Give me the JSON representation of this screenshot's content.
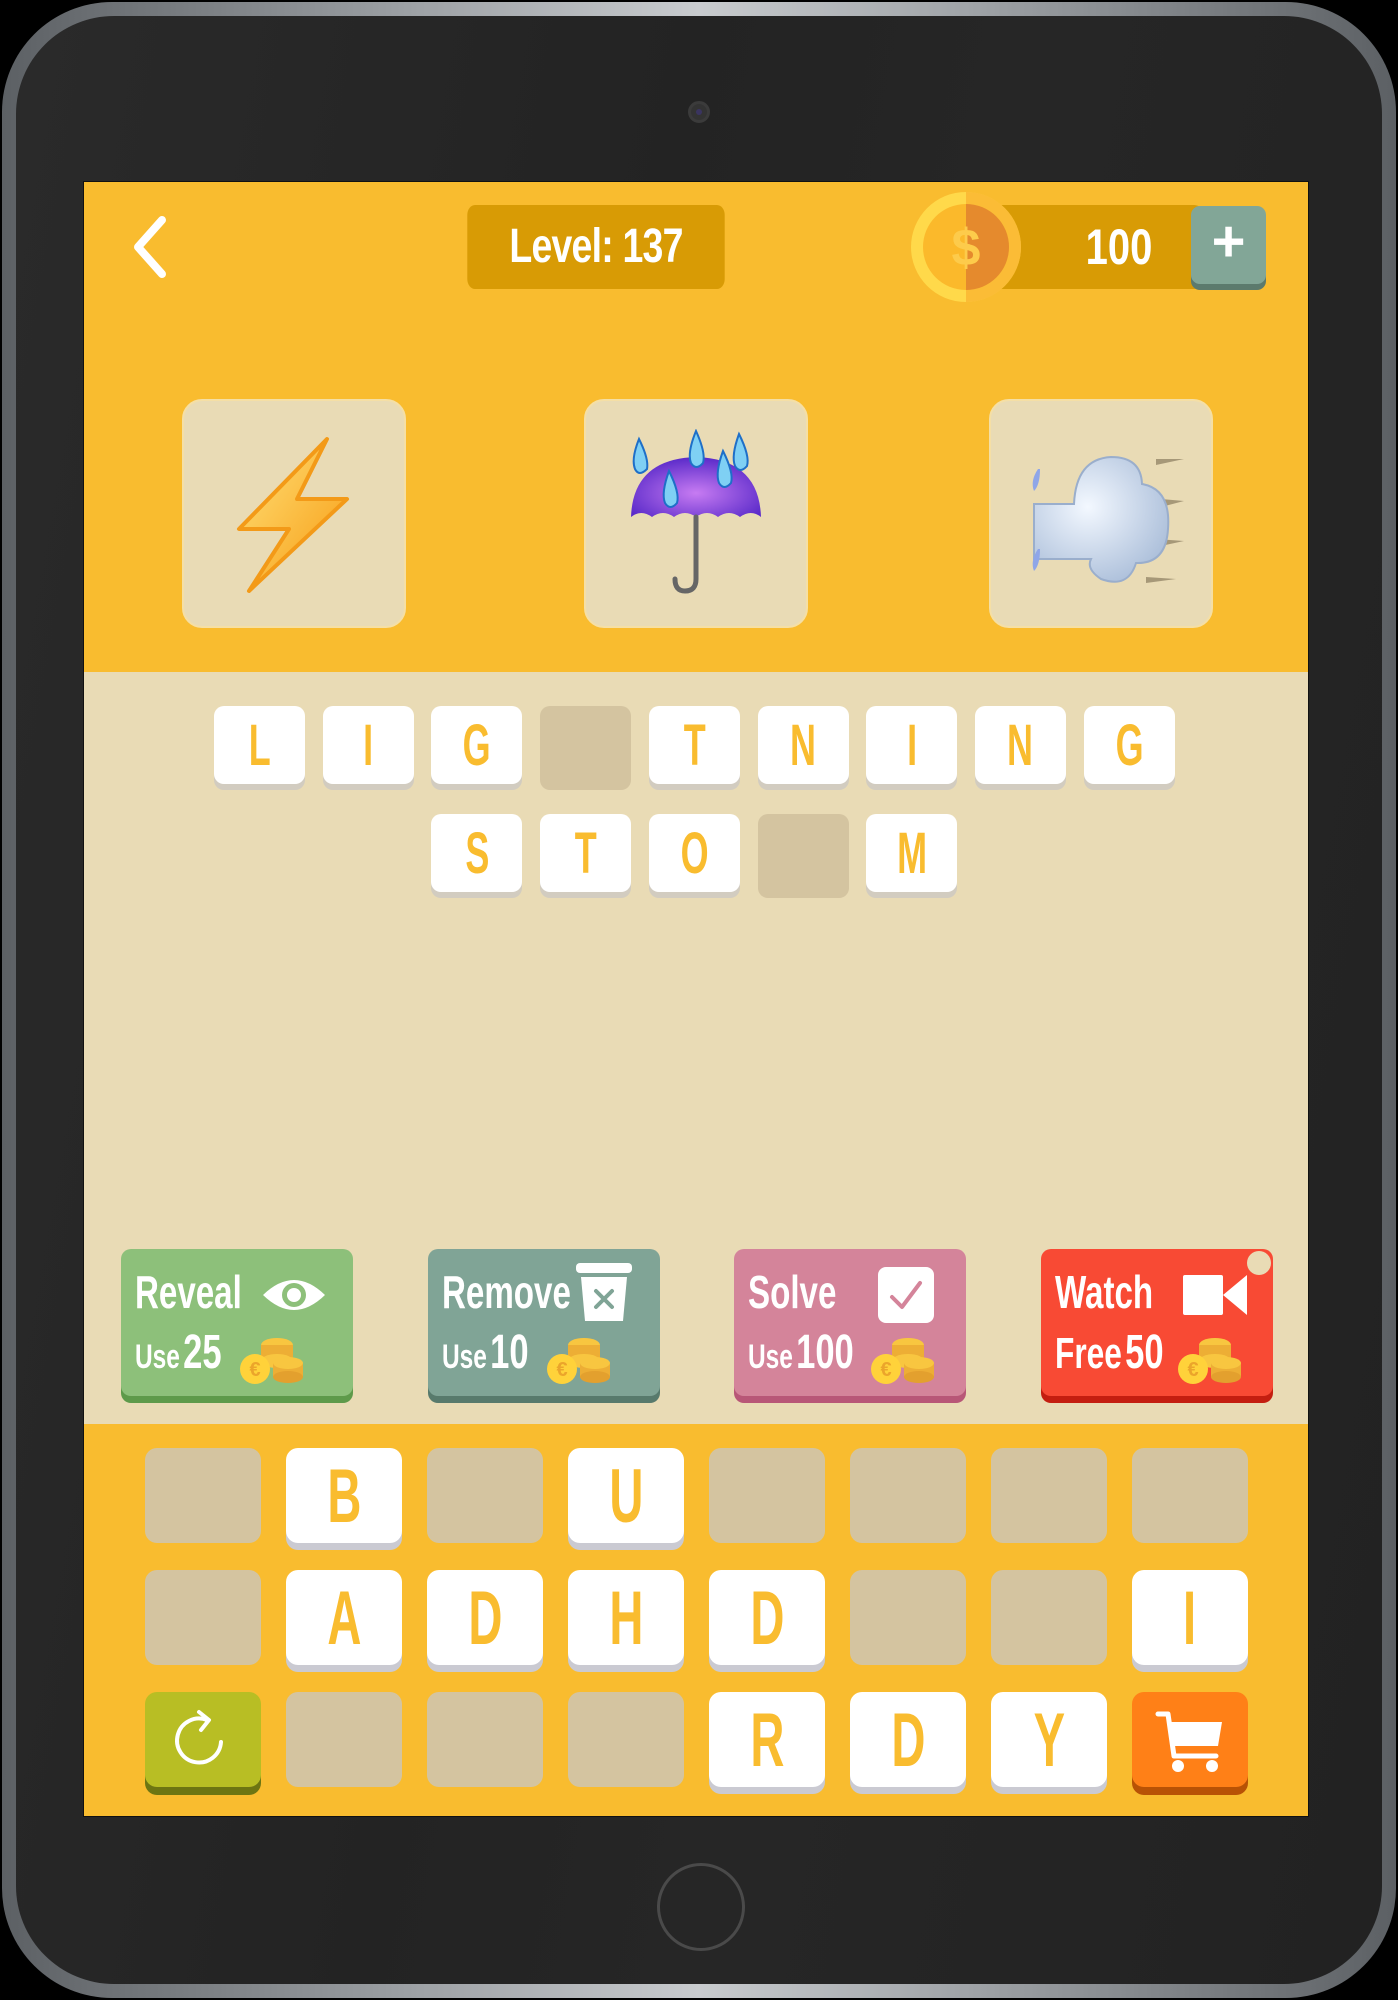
{
  "header": {
    "back_icon": "chevron-left-icon",
    "level_label": "Level: 137",
    "coins": "100",
    "coin_icon": "dollar-coin-icon",
    "add_coins_label": "+"
  },
  "clues": [
    {
      "emoji": "high-voltage",
      "icon": "lightning-bolt-icon"
    },
    {
      "emoji": "umbrella-with-rain-drops",
      "icon": "umbrella-rain-icon"
    },
    {
      "emoji": "wind-blowing-face",
      "icon": "wind-cloud-icon"
    }
  ],
  "answer": {
    "rows": [
      [
        "L",
        "I",
        "G",
        "",
        "T",
        "N",
        "I",
        "N",
        "G"
      ],
      [
        "S",
        "T",
        "O",
        "",
        "M"
      ]
    ]
  },
  "hints": [
    {
      "title": "Reveal",
      "prefix": "Use",
      "amount": "25",
      "icon": "eye-icon",
      "color": "#8DC07A"
    },
    {
      "title": "Remove",
      "prefix": "Use",
      "amount": "10",
      "icon": "trash-x-icon",
      "color": "#80A496"
    },
    {
      "title": "Solve",
      "prefix": "Use",
      "amount": "100",
      "icon": "checkbox-icon",
      "color": "#D4849A"
    },
    {
      "title": "Watch",
      "prefix": "Free",
      "amount": "50",
      "icon": "video-camera-icon",
      "color": "#F84A34"
    }
  ],
  "keyboard": {
    "rows": [
      [
        "",
        "B",
        "",
        "U",
        "",
        "",
        "",
        ""
      ],
      [
        "",
        "A",
        "D",
        "H",
        "D",
        "",
        "",
        "I"
      ],
      [
        "reset",
        "",
        "",
        "",
        "R",
        "D",
        "Y",
        "shop"
      ]
    ],
    "reset_icon": "refresh-icon",
    "shop_icon": "shopping-cart-icon"
  },
  "colors": {
    "primary_yellow": "#F9BC2F",
    "beige": "#E9DBB5",
    "empty_slot": "#D4C4A0",
    "level_pill": "#D89B05"
  }
}
